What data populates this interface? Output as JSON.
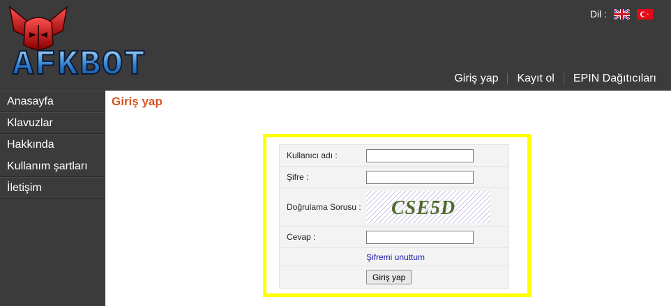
{
  "logo": {
    "text": "AFKBOT"
  },
  "header": {
    "lang_label": "Dil :",
    "flags": [
      "uk-flag-icon",
      "turkey-flag-icon"
    ],
    "nav": [
      {
        "label": "Giriş yap"
      },
      {
        "label": "Kayıt ol"
      },
      {
        "label": "EPIN Dağıtıcıları"
      }
    ]
  },
  "sidebar": {
    "items": [
      {
        "label": "Anasayfa"
      },
      {
        "label": "Klavuzlar"
      },
      {
        "label": "Hakkında"
      },
      {
        "label": "Kullanım şartları"
      },
      {
        "label": "İletişim"
      }
    ]
  },
  "main": {
    "title": "Giriş yap",
    "form": {
      "username_label": "Kullanıcı adı :",
      "username_value": "",
      "password_label": "Şifre :",
      "password_value": "",
      "captcha_label": "Doğrulama Sorusu :",
      "captcha_text": "CSE5D",
      "answer_label": "Cevap :",
      "answer_value": "",
      "forgot_link": "Şifremi unuttum",
      "submit_label": "Giriş yap"
    }
  },
  "colors": {
    "header_bg": "#3b3b3b",
    "title_color": "#d9531e",
    "highlight_border": "#ffff00",
    "link_color": "#1a1aa8"
  }
}
